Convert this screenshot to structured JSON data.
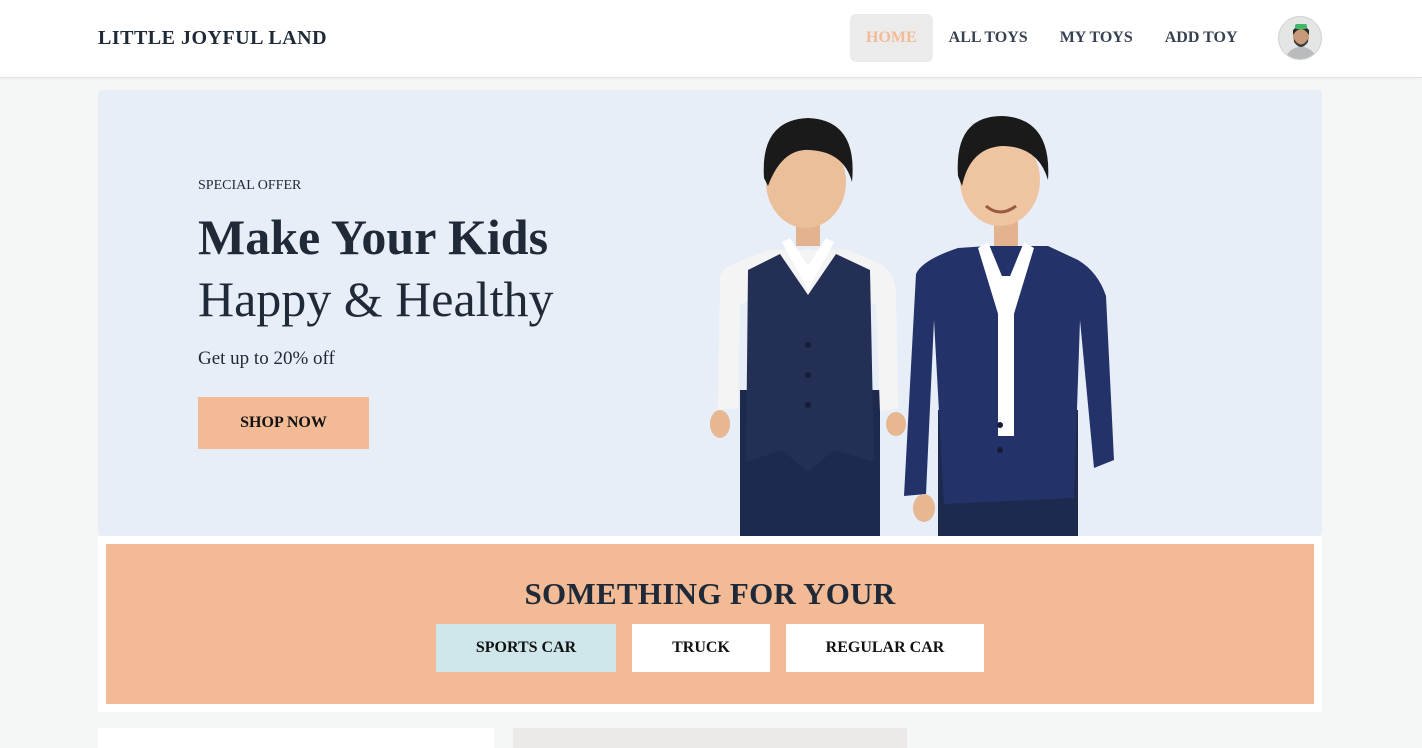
{
  "brand": "LITTLE JOYFUL LAND",
  "nav": {
    "items": [
      {
        "label": "HOME",
        "active": true
      },
      {
        "label": "ALL TOYS"
      },
      {
        "label": "MY TOYS"
      },
      {
        "label": "ADD TOY"
      }
    ]
  },
  "hero": {
    "eyebrow": "SPECIAL OFFER",
    "title_line1": "Make Your Kids",
    "title_line2": "Happy & Healthy",
    "subtitle": "Get up to 20% off",
    "cta_label": "SHOP NOW"
  },
  "categories": {
    "title": "SOMETHING FOR YOUR",
    "tabs": [
      {
        "label": "SPORTS CAR",
        "active": true
      },
      {
        "label": "TRUCK"
      },
      {
        "label": "REGULAR CAR"
      }
    ]
  },
  "colors": {
    "accent": "#f2bb96",
    "hero_bg": "#e7eef8",
    "active_tab": "#cfe6ea",
    "suit_navy": "#1e2a4d"
  }
}
